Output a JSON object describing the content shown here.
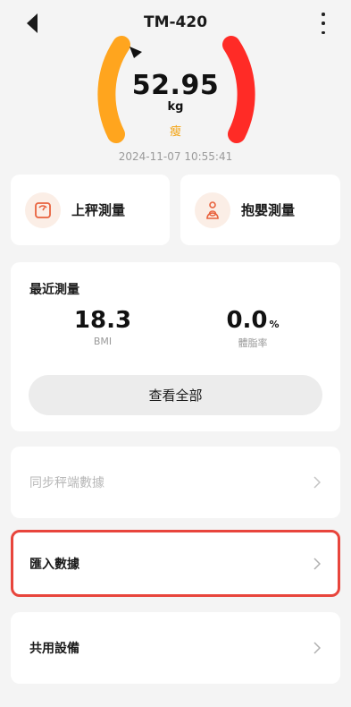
{
  "header": {
    "title": "TM-420",
    "back_icon": "back-arrow-icon",
    "more_icon": "more-vertical-icon"
  },
  "gauge": {
    "weight": "52.95",
    "unit": "kg",
    "status": "瘦",
    "timestamp": "2024-11-07 10:55:41",
    "colors": {
      "left_arc": "#ffa51e",
      "right_arc": "#ff2b26",
      "status": "#f3a20f"
    }
  },
  "actions": [
    {
      "label": "上秤測量",
      "icon": "scale-icon"
    },
    {
      "label": "抱嬰測量",
      "icon": "baby-hold-icon"
    }
  ],
  "recent": {
    "title": "最近測量",
    "bmi": {
      "value": "18.3",
      "label": "BMI"
    },
    "body_fat": {
      "value": "0.0",
      "unit": "%",
      "label": "體脂率"
    },
    "view_all_label": "查看全部"
  },
  "menu": {
    "sync_label": "同步秤端數據",
    "import_label": "匯入數據",
    "share_label": "共用設備"
  },
  "accent": {
    "highlight": "#e8453c",
    "icon_bg": "#fbeee6",
    "icon_stroke": "#e8623e"
  }
}
